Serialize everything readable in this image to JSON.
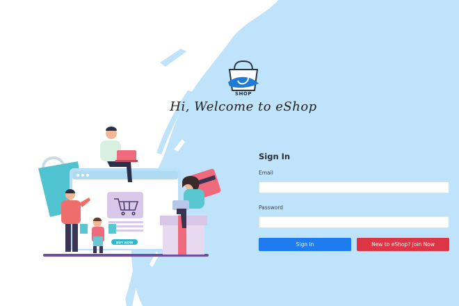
{
  "brand": {
    "logo_text": "SHOP",
    "welcome": "Hi, Welcome to eShop"
  },
  "signin": {
    "title": "Sign In",
    "email_label": "Email",
    "email_value": "",
    "password_label": "Password",
    "password_value": "",
    "submit_label": "Sign In",
    "join_label": "New to eShop? Join Now"
  },
  "illustration": {
    "buy_now_label": "BUY NOW"
  },
  "colors": {
    "background_splash": "#bfe3fb",
    "primary_button": "#1e7bf0",
    "danger_button": "#de3545"
  },
  "icons": [
    "shopping-bag-logo-icon",
    "shopping-cart-icon"
  ]
}
